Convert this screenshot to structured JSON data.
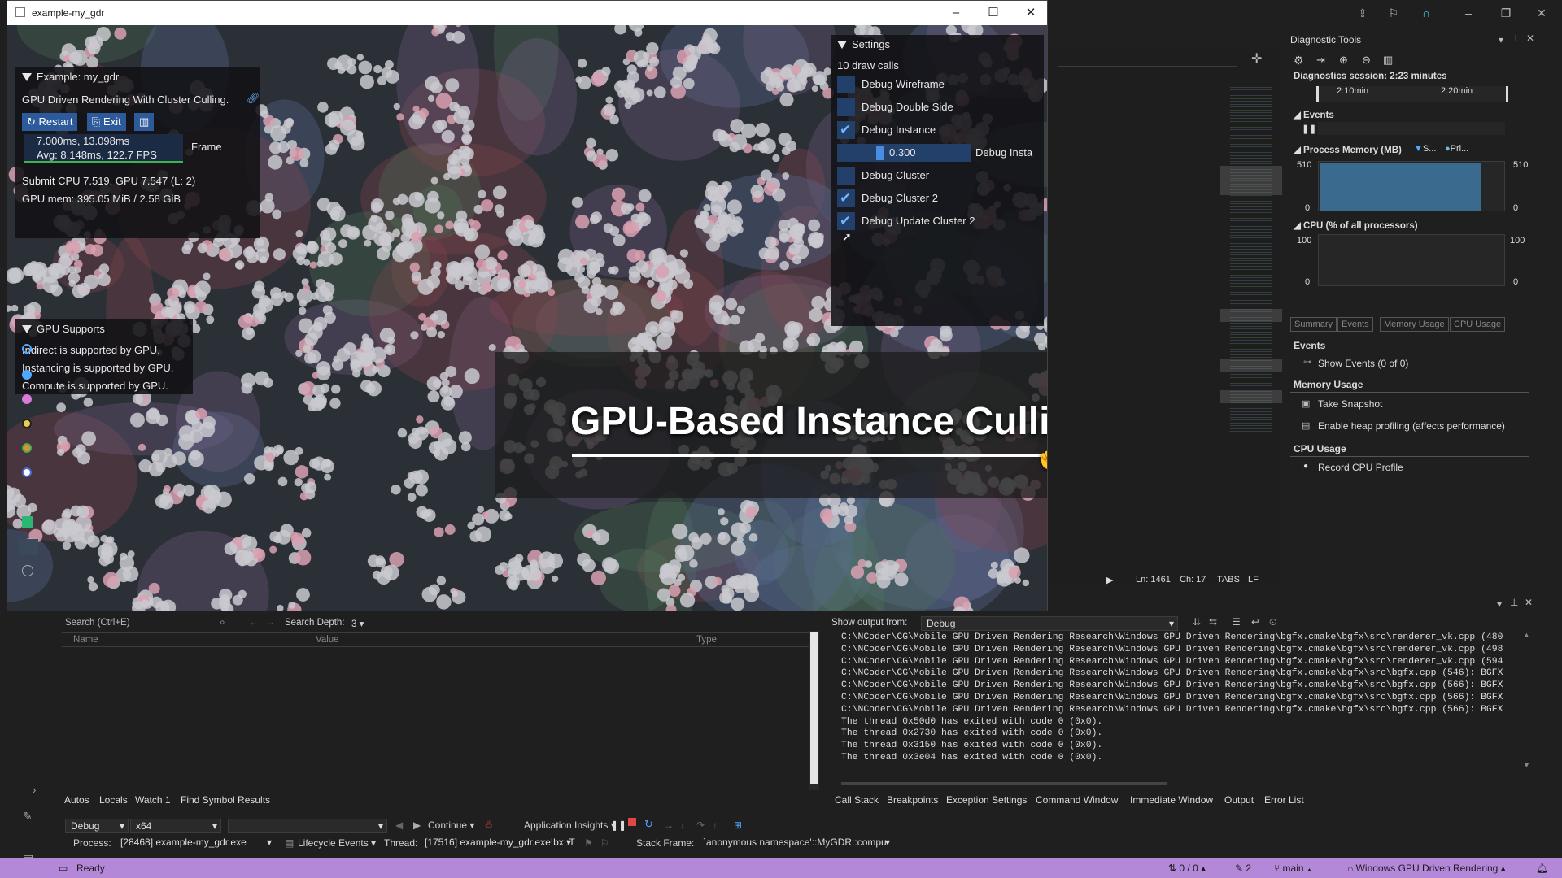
{
  "app_window": {
    "title": "example-my_gdr",
    "overlay_title": "GPU-Based Instance Culling"
  },
  "example_panel": {
    "header": "Example: my_gdr",
    "description": "GPU Driven Rendering With Cluster Culling.",
    "restart_label": "Restart",
    "exit_label": "Exit",
    "timing_line1": "7.000ms, 13.098ms",
    "timing_line2": "Avg: 8.148ms, 122.7 FPS",
    "frame_label": "Frame",
    "submit_line": "Submit CPU 7.519, GPU 7.547 (L: 2)",
    "gpu_mem_line": "GPU mem: 395.05 MiB / 2.58 GiB"
  },
  "gpu_supports_panel": {
    "header": "GPU Supports",
    "lines": [
      "Indirect is supported by GPU.",
      "Instancing is supported by GPU.",
      "Compute is supported by GPU."
    ]
  },
  "settings_panel": {
    "header": "Settings",
    "draw_calls": "10 draw calls",
    "items": [
      {
        "label": "Debug Wireframe",
        "checked": false
      },
      {
        "label": "Debug Double Side",
        "checked": false
      },
      {
        "label": "Debug Instance",
        "checked": true
      },
      {
        "label": "Debug Cluster",
        "checked": false
      },
      {
        "label": "Debug Cluster 2",
        "checked": true
      },
      {
        "label": "Debug Update Cluster 2",
        "checked": true
      }
    ],
    "slider_value": "0.300",
    "slider_label": "Debug Insta"
  },
  "diagnostics": {
    "title": "Diagnostic Tools",
    "session": "Diagnostics session: 2:23 minutes",
    "tick1": "2:10min",
    "tick2": "2:20min",
    "events_label": "Events",
    "process_memory_label": "Process Memory (MB)",
    "legend1": "S...",
    "legend2": "Pri...",
    "mem_max_left": "510",
    "mem_max_right": "510",
    "mem_min_left": "0",
    "mem_min_right": "0",
    "cpu_label": "CPU (% of all processors)",
    "cpu_max_left": "100",
    "cpu_max_right": "100",
    "cpu_min_left": "0",
    "cpu_min_right": "0",
    "tabs": [
      "Summary",
      "Events",
      "Memory Usage",
      "CPU Usage"
    ],
    "sec_events": "Events",
    "show_events": "Show Events (0 of 0)",
    "sec_memory": "Memory Usage",
    "take_snapshot": "Take Snapshot",
    "heap_profiling": "Enable heap profiling (affects performance)",
    "sec_cpu": "CPU Usage",
    "record_cpu": "Record CPU Profile"
  },
  "editor_status": {
    "ln": "Ln: 1461",
    "ch": "Ch: 17",
    "tabs": "TABS",
    "lf": "LF"
  },
  "autos": {
    "search_placeholder": "Search (Ctrl+E)",
    "search_depth_label": "Search Depth:",
    "search_depth_value": "3",
    "col_name": "Name",
    "col_value": "Value",
    "col_type": "Type",
    "tabs": [
      "Autos",
      "Locals",
      "Watch 1",
      "Find Symbol Results"
    ]
  },
  "output": {
    "show_output_label": "Show output from:",
    "source": "Debug",
    "lines": [
      "C:\\NCoder\\CG\\Mobile GPU Driven Rendering Research\\Windows GPU Driven Rendering\\bgfx.cmake\\bgfx\\src\\renderer_vk.cpp (480",
      "C:\\NCoder\\CG\\Mobile GPU Driven Rendering Research\\Windows GPU Driven Rendering\\bgfx.cmake\\bgfx\\src\\renderer_vk.cpp (498",
      "C:\\NCoder\\CG\\Mobile GPU Driven Rendering Research\\Windows GPU Driven Rendering\\bgfx.cmake\\bgfx\\src\\renderer_vk.cpp (594",
      "C:\\NCoder\\CG\\Mobile GPU Driven Rendering Research\\Windows GPU Driven Rendering\\bgfx.cmake\\bgfx\\src\\bgfx.cpp (546): BGFX",
      "C:\\NCoder\\CG\\Mobile GPU Driven Rendering Research\\Windows GPU Driven Rendering\\bgfx.cmake\\bgfx\\src\\bgfx.cpp (566): BGFX",
      "C:\\NCoder\\CG\\Mobile GPU Driven Rendering Research\\Windows GPU Driven Rendering\\bgfx.cmake\\bgfx\\src\\bgfx.cpp (566): BGFX",
      "C:\\NCoder\\CG\\Mobile GPU Driven Rendering Research\\Windows GPU Driven Rendering\\bgfx.cmake\\bgfx\\src\\bgfx.cpp (566): BGFX",
      "The thread 0x50d0 has exited with code 0 (0x0).",
      "The thread 0x2730 has exited with code 0 (0x0).",
      "The thread 0x3150 has exited with code 0 (0x0).",
      "The thread 0x3e04 has exited with code 0 (0x0)."
    ],
    "tabs": [
      "Call Stack",
      "Breakpoints",
      "Exception Settings",
      "Command Window",
      "Immediate Window",
      "Output",
      "Error List"
    ]
  },
  "debug_toolbar": {
    "config": "Debug",
    "platform": "x64",
    "continue_label": "Continue",
    "app_insights": "Application Insights",
    "process_label": "Process:",
    "process_value": "[28468] example-my_gdr.exe",
    "lifecycle_label": "Lifecycle Events",
    "thread_label": "Thread:",
    "thread_value": "[17516] example-my_gdr.exe!bx::T",
    "stack_frame_label": "Stack Frame:",
    "stack_frame_value": "`anonymous namespace'::MyGDR::compu"
  },
  "statusbar": {
    "ready": "Ready",
    "changes": "0 / 0",
    "edits": "2",
    "branch": "main",
    "repo": "Windows GPU Driven Rendering"
  }
}
